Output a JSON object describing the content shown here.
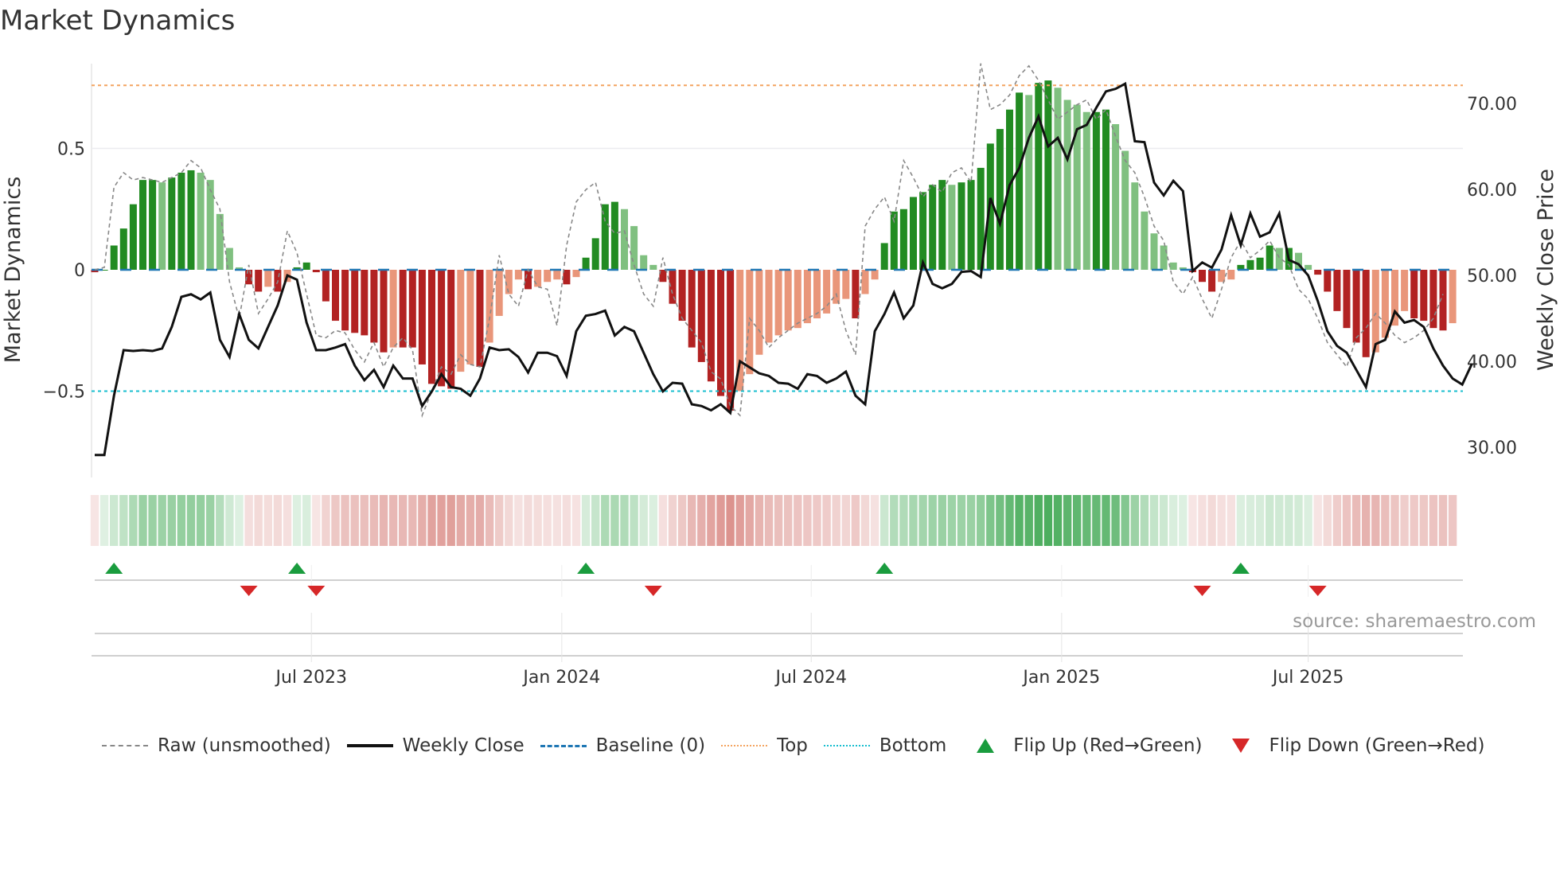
{
  "chart_data": {
    "type": "bar",
    "title": "Market Dynamics",
    "ylabel": "Market Dynamics",
    "y2label": "Weekly Close Price",
    "ylim": [
      -0.88,
      0.92
    ],
    "y2lim": [
      26,
      75.5
    ],
    "yticks": [
      {
        "v": 0.5,
        "label": "0.5"
      },
      {
        "v": 0,
        "label": "0"
      },
      {
        "v": -0.5,
        "label": "−0.5"
      }
    ],
    "y2ticks": [
      {
        "v": 70,
        "label": "70.00"
      },
      {
        "v": 60,
        "label": "60.00"
      },
      {
        "v": 50,
        "label": "50.00"
      },
      {
        "v": 40,
        "label": "40.00"
      },
      {
        "v": 30,
        "label": "30.00"
      }
    ],
    "xticks": [
      {
        "week": 22.5,
        "label": "Jul 2023"
      },
      {
        "week": 48.5,
        "label": "Jan 2024"
      },
      {
        "week": 74.4,
        "label": "Jul 2024"
      },
      {
        "week": 100.4,
        "label": "Jan 2025"
      },
      {
        "week": 126,
        "label": "Jul 2025"
      }
    ],
    "top_level": 0.76,
    "bottom_level": -0.5,
    "baseline": 0,
    "smoothed": [
      -0.01,
      0.0,
      0.1,
      0.17,
      0.27,
      0.37,
      0.37,
      0.36,
      0.38,
      0.4,
      0.41,
      0.4,
      0.37,
      0.23,
      0.09,
      0.01,
      -0.06,
      -0.09,
      -0.07,
      -0.09,
      -0.05,
      0.01,
      0.03,
      -0.01,
      -0.13,
      -0.21,
      -0.25,
      -0.26,
      -0.27,
      -0.3,
      -0.34,
      -0.32,
      -0.32,
      -0.32,
      -0.39,
      -0.47,
      -0.48,
      -0.49,
      -0.42,
      -0.39,
      -0.4,
      -0.3,
      -0.19,
      -0.1,
      -0.04,
      -0.08,
      -0.07,
      -0.05,
      -0.04,
      -0.06,
      -0.03,
      0.05,
      0.13,
      0.27,
      0.28,
      0.25,
      0.18,
      0.06,
      0.02,
      -0.05,
      -0.14,
      -0.21,
      -0.32,
      -0.38,
      -0.46,
      -0.52,
      -0.58,
      -0.5,
      -0.43,
      -0.35,
      -0.3,
      -0.27,
      -0.25,
      -0.24,
      -0.22,
      -0.2,
      -0.18,
      -0.14,
      -0.12,
      -0.2,
      -0.1,
      -0.04,
      0.11,
      0.24,
      0.25,
      0.3,
      0.32,
      0.35,
      0.37,
      0.35,
      0.36,
      0.37,
      0.42,
      0.52,
      0.58,
      0.66,
      0.73,
      0.72,
      0.77,
      0.78,
      0.75,
      0.7,
      0.68,
      0.65,
      0.65,
      0.66,
      0.6,
      0.49,
      0.36,
      0.24,
      0.15,
      0.1,
      0.03,
      0.01,
      -0.01,
      -0.05,
      -0.09,
      -0.05,
      -0.04,
      0.02,
      0.04,
      0.05,
      0.1,
      0.09,
      0.09,
      0.07,
      0.02,
      -0.02,
      -0.09,
      -0.17,
      -0.24,
      -0.3,
      -0.36,
      -0.34,
      -0.28,
      -0.23,
      -0.17,
      -0.2,
      -0.21,
      -0.24,
      -0.25,
      -0.22
    ],
    "raw": [
      0.0,
      0.01,
      0.34,
      0.4,
      0.37,
      0.38,
      0.37,
      0.36,
      0.38,
      0.4,
      0.45,
      0.42,
      0.33,
      0.25,
      -0.05,
      -0.2,
      0.02,
      -0.18,
      -0.12,
      -0.05,
      0.16,
      0.07,
      -0.1,
      -0.27,
      -0.28,
      -0.25,
      -0.26,
      -0.33,
      -0.38,
      -0.3,
      -0.4,
      -0.32,
      -0.28,
      -0.33,
      -0.6,
      -0.5,
      -0.4,
      -0.43,
      -0.35,
      -0.39,
      -0.4,
      -0.2,
      0.06,
      -0.1,
      -0.15,
      0.0,
      -0.07,
      -0.08,
      -0.23,
      0.1,
      0.28,
      0.33,
      0.36,
      0.2,
      0.15,
      0.16,
      0.02,
      -0.1,
      -0.15,
      0.05,
      -0.1,
      -0.2,
      -0.25,
      -0.3,
      -0.42,
      -0.45,
      -0.56,
      -0.6,
      -0.2,
      -0.25,
      -0.32,
      -0.28,
      -0.25,
      -0.22,
      -0.2,
      -0.18,
      -0.15,
      -0.1,
      -0.25,
      -0.35,
      0.18,
      0.25,
      0.3,
      0.2,
      0.45,
      0.38,
      0.3,
      0.35,
      0.32,
      0.4,
      0.42,
      0.36,
      0.85,
      0.66,
      0.68,
      0.72,
      0.8,
      0.84,
      0.78,
      0.7,
      0.62,
      0.65,
      0.68,
      0.7,
      0.62,
      0.66,
      0.55,
      0.45,
      0.4,
      0.3,
      0.18,
      0.12,
      -0.05,
      -0.1,
      -0.03,
      -0.12,
      -0.2,
      -0.08,
      0.05,
      0.12,
      0.05,
      0.08,
      0.12,
      0.05,
      0.02,
      -0.08,
      -0.12,
      -0.2,
      -0.3,
      -0.35,
      -0.4,
      -0.28,
      -0.24,
      -0.18,
      -0.22,
      -0.27,
      -0.3,
      -0.28,
      -0.25,
      -0.2,
      -0.1
    ],
    "weekly_close": [
      29.1,
      29.1,
      36.0,
      41.3,
      41.2,
      41.3,
      41.2,
      41.5,
      44.0,
      47.5,
      47.8,
      47.2,
      48.0,
      42.5,
      40.5,
      45.5,
      42.5,
      41.5,
      44.0,
      46.5,
      50.0,
      49.5,
      44.5,
      41.3,
      41.3,
      41.6,
      42.0,
      39.5,
      37.8,
      39.0,
      37.0,
      39.5,
      38.0,
      38.0,
      34.8,
      36.5,
      38.5,
      37.0,
      36.8,
      36.0,
      38.0,
      41.6,
      41.3,
      41.4,
      40.5,
      38.7,
      41.0,
      41.0,
      40.6,
      38.3,
      43.5,
      45.3,
      45.5,
      45.9,
      43.0,
      44.0,
      43.5,
      41.0,
      38.5,
      36.5,
      37.5,
      37.4,
      35.0,
      34.8,
      34.3,
      35.0,
      34.0,
      40.0,
      39.3,
      38.6,
      38.3,
      37.5,
      37.4,
      36.8,
      38.5,
      38.3,
      37.5,
      38.0,
      38.8,
      36.0,
      35.0,
      43.5,
      45.5,
      48.0,
      45.0,
      46.5,
      51.5,
      49.0,
      48.5,
      49.0,
      50.4,
      50.5,
      49.8,
      59.0,
      56.0,
      60.5,
      62.5,
      66.0,
      68.5,
      65.0,
      66.0,
      63.5,
      67.0,
      67.5,
      69.5,
      71.4,
      71.7,
      72.3,
      65.6,
      65.5,
      60.8,
      59.3,
      61.0,
      59.8,
      50.5,
      51.5,
      50.9,
      53.0,
      57.0,
      53.5,
      57.2,
      54.5,
      55.0,
      57.2,
      51.8,
      51.3,
      50.0,
      47.0,
      43.5,
      41.8,
      41.0,
      39.0,
      37.0,
      42.0,
      42.5,
      45.8,
      44.5,
      44.8,
      44.0,
      41.5,
      39.5,
      38.0,
      37.3,
      39.7
    ],
    "flip_up_weeks": [
      2,
      21,
      51,
      82,
      119
    ],
    "flip_down_weeks": [
      16,
      23,
      58,
      115,
      127
    ],
    "legend_placement": "bottom"
  },
  "colors": {
    "green_strong": "#228b22",
    "green_weak": "#80c080",
    "red_strong": "#b22222",
    "red_weak": "#e9967a",
    "raw": "#888888",
    "close": "#111111",
    "baseline": "#1f77b4",
    "top": "#f4a460",
    "bottom": "#17becf",
    "flip_up": "#1a9c3e",
    "flip_down": "#d62728"
  },
  "legend": [
    {
      "key": "raw",
      "label": "Raw (unsmoothed)"
    },
    {
      "key": "close",
      "label": "Weekly Close"
    },
    {
      "key": "baseline",
      "label": "Baseline (0)"
    },
    {
      "key": "top",
      "label": "Top"
    },
    {
      "key": "bottom",
      "label": "Bottom"
    },
    {
      "key": "flip_up",
      "label": "Flip Up (Red→Green)"
    },
    {
      "key": "flip_down",
      "label": "Flip Down (Green→Red)"
    }
  ],
  "source": "source: sharemaestro.com"
}
